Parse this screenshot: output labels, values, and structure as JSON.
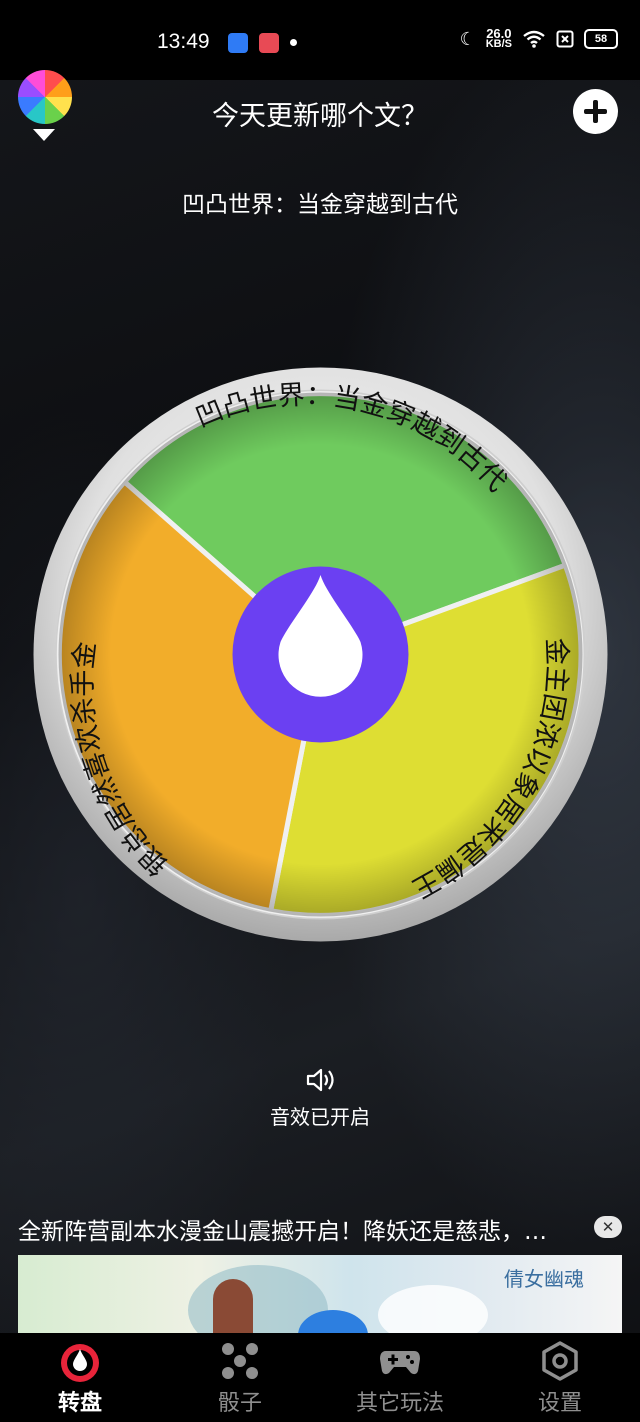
{
  "status_bar": {
    "time": "13:49",
    "net_speed": "26.0",
    "net_unit": "KB/S",
    "battery": "58"
  },
  "header": {
    "title": "今天更新哪个文？",
    "palette_icon": "color-palette-icon",
    "add_icon": "plus-icon"
  },
  "result_text": "凹凸世界：当金穿越到古代",
  "wheel": {
    "segments": [
      {
        "label": "凹凸世界：当金穿越到古代",
        "color": "#6fcb5e"
      },
      {
        "label": "金主团浓以象居来是偏王？…",
        "color": "#dede33"
      },
      {
        "label": "银总居然喜欢杀手金",
        "color": "#f2ad2a"
      }
    ],
    "hub_color": "#6b40f2"
  },
  "sound": {
    "icon": "speaker-icon",
    "label": "音效已开启"
  },
  "ad": {
    "text": "全新阵营副本水漫金山震撼开启！降妖还是慈悲，…",
    "close": "✕",
    "logo": "倩女幽魂"
  },
  "bottom_nav": [
    {
      "label": "转盘",
      "icon": "wheel-icon",
      "active": true
    },
    {
      "label": "骰子",
      "icon": "dice-icon",
      "active": false
    },
    {
      "label": "其它玩法",
      "icon": "gamepad-icon",
      "active": false
    },
    {
      "label": "设置",
      "icon": "settings-icon",
      "active": false
    }
  ]
}
